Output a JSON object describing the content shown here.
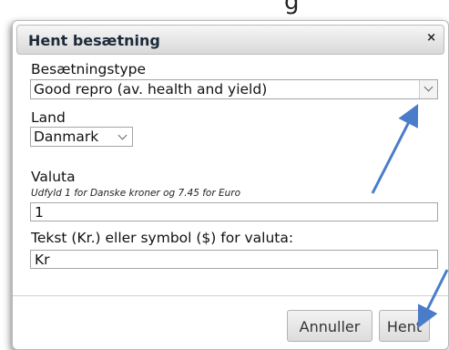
{
  "page_top_fragment": "g",
  "dialog": {
    "title": "Hent besætning",
    "close_symbol": "×",
    "herd_type": {
      "label": "Besætningstype",
      "selected": "Good repro (av. health and yield)"
    },
    "country": {
      "label": "Land",
      "selected": "Danmark"
    },
    "currency": {
      "label": "Valuta",
      "hint": "Udfyld 1 for Danske kroner og 7.45 for Euro",
      "value": "1"
    },
    "currency_text": {
      "label": "Tekst (Kr.) eller symbol ($) for valuta:",
      "value": "Kr"
    },
    "buttons": {
      "cancel": "Annuller",
      "fetch": "Hent"
    }
  },
  "colors": {
    "annotation_arrow": "#4a7cc9"
  }
}
